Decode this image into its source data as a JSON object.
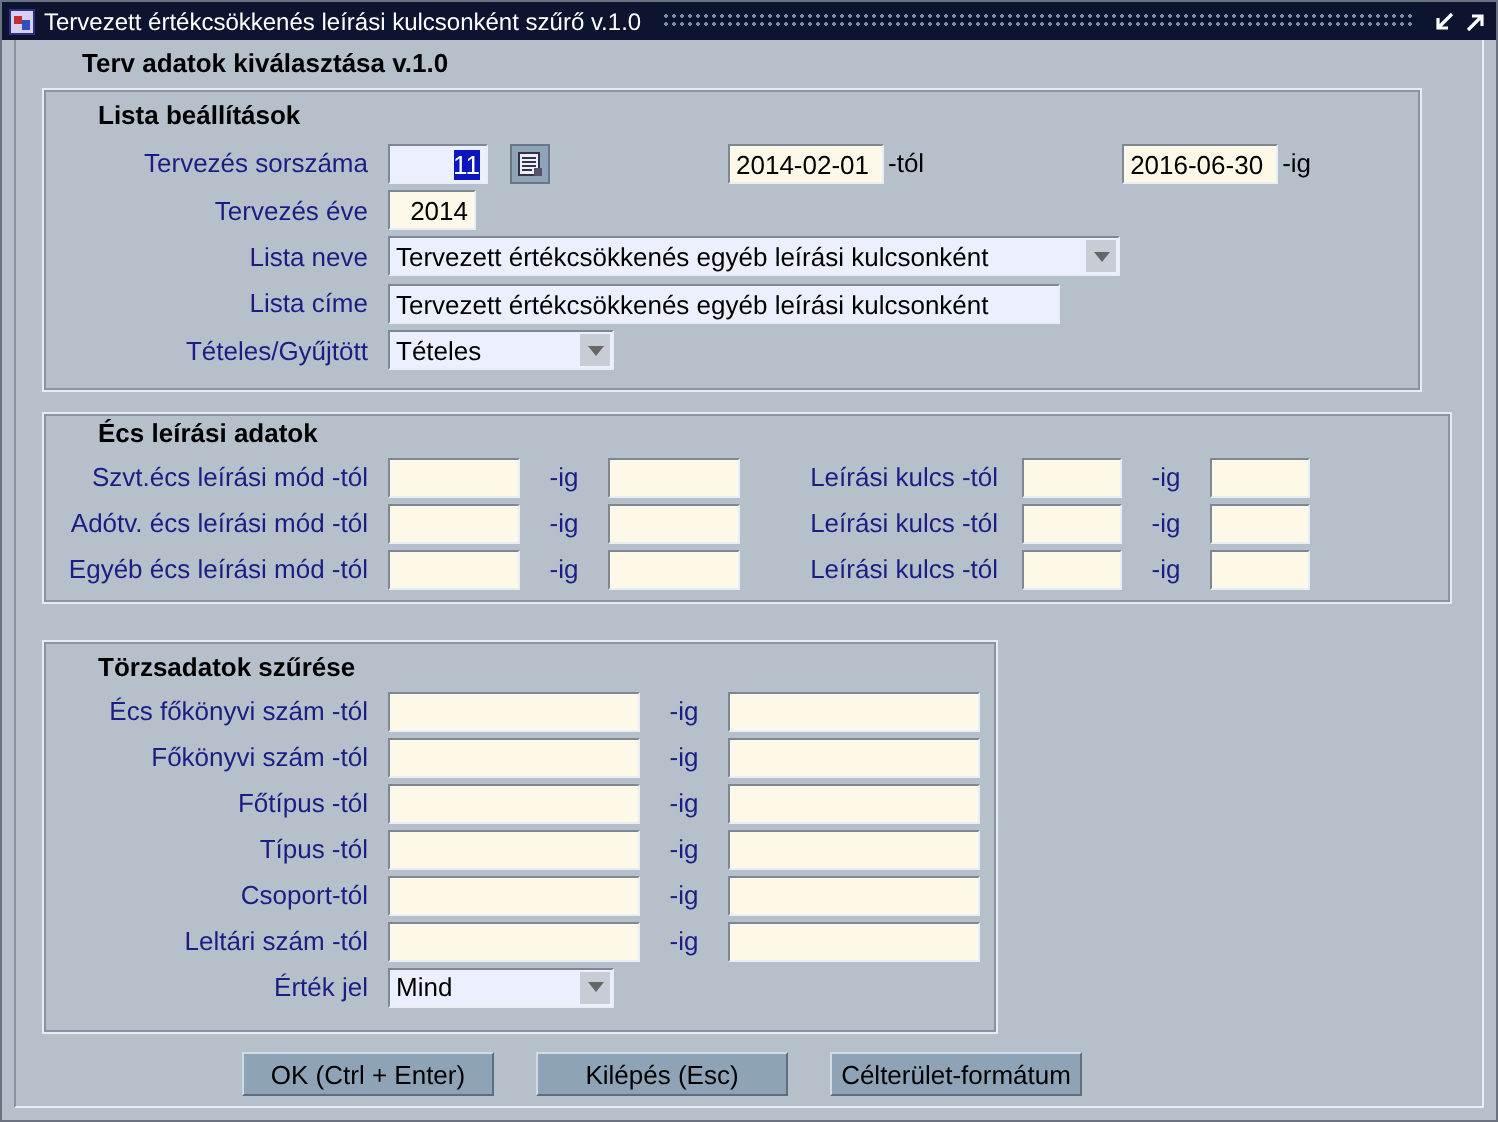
{
  "window": {
    "title": "Tervezett értékcsökkenés leírási kulcsonként szűrő v.1.0"
  },
  "form_title": "Terv adatok kiválasztása v.1.0",
  "lista": {
    "title": "Lista beállítások",
    "sorszama": {
      "label": "Tervezés sorszáma",
      "value": "11",
      "selected": true,
      "required": true
    },
    "date_from": {
      "value": "2014-02-01",
      "suffix": "-tól",
      "required": false
    },
    "date_to": {
      "value": "2016-06-30",
      "suffix": "-ig",
      "required": false
    },
    "ev": {
      "label": "Tervezés éve",
      "value": "2014",
      "required": false
    },
    "rows": [
      {
        "kind": "dropdown",
        "label": "Lista neve",
        "value": "Tervezett értékcsökkenés egyéb leírási kulcsonként",
        "required": true
      },
      {
        "kind": "text",
        "label": "Lista címe",
        "value": "Tervezett értékcsökkenés egyéb leírási kulcsonként",
        "required": true
      },
      {
        "kind": "dropdown",
        "label": "Tételes/Gyűjtött",
        "value": "Tételes",
        "required": true
      }
    ]
  },
  "ecs": {
    "title": "Écs leírási adatok",
    "rows": [
      {
        "label": "Szvt.écs leírási mód -tól",
        "to_label": "-ig",
        "key_label": "Leírási kulcs -tól",
        "key_to_label": "-ig"
      },
      {
        "label": "Adótv. écs leírási mód -tól",
        "to_label": "-ig",
        "key_label": "Leírási kulcs -tól",
        "key_to_label": "-ig"
      },
      {
        "label": "Egyéb écs leírási mód -tól",
        "to_label": "-ig",
        "key_label": "Leírási kulcs -tól",
        "key_to_label": "-ig"
      }
    ]
  },
  "torzs": {
    "title": "Törzsadatok szűrése",
    "rows": [
      {
        "label": "Écs főkönyvi szám -tól",
        "to_label": "-ig"
      },
      {
        "label": "Főkönyvi szám -tól",
        "to_label": "-ig"
      },
      {
        "label": "Főtípus -tól",
        "to_label": "-ig"
      },
      {
        "label": "Típus -tól",
        "to_label": "-ig"
      },
      {
        "label": "Csoport-tól",
        "to_label": "-ig"
      },
      {
        "label": "Leltári szám -tól",
        "to_label": "-ig"
      }
    ],
    "value_sign": {
      "label": "Érték jel",
      "value": "Mind",
      "required": true
    }
  },
  "buttons": [
    "OK (Ctrl + Enter)",
    "Kilépés (Esc)",
    "Célterület-formátum"
  ]
}
